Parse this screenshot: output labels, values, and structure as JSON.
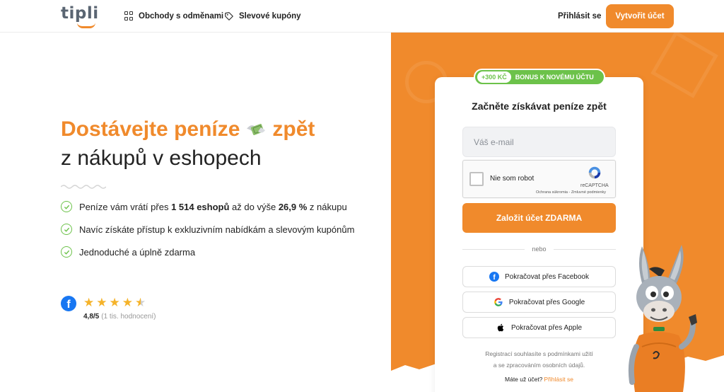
{
  "header": {
    "logo_text": "tipli",
    "nav": [
      {
        "label": "Obchody s odměnami",
        "icon": "grid-icon"
      },
      {
        "label": "Slevové kupóny",
        "icon": "tag-icon"
      }
    ],
    "login_label": "Přihlásit se",
    "create_account_label": "Vytvořit účet"
  },
  "hero": {
    "headline_highlight": "Dostávejte peníze",
    "headline_highlight_end": "zpět",
    "headline_rest": "z nákupů v eshopech",
    "benefits": [
      {
        "pre": "Peníze vám vrátí přes ",
        "bold1": "1 514 eshopů",
        "mid": " až do výše ",
        "bold2": "26,9 %",
        "post": " z nákupu"
      },
      {
        "text": "Navíc získáte přístup k exkluzivním nabídkám a slevovým kupónům"
      },
      {
        "text": "Jednoduché a úplně zdarma"
      }
    ],
    "rating": {
      "value": "4,8/5",
      "count": "(1 tis. hodnocení)",
      "stars": 4.5
    }
  },
  "signup": {
    "bonus_amount": "+300 KČ",
    "bonus_label": "BONUS K NOVÉMU ÚČTU",
    "title": "Začněte získávat peníze zpět",
    "email_placeholder": "Váš e-mail",
    "captcha_label": "Nie som robot",
    "captcha_brand": "reCAPTCHA",
    "captcha_links": "Ochrana súkromia - Zmluvné podmienky",
    "submit_label": "Založit účet ZDARMA",
    "or_label": "nebo",
    "social": [
      {
        "label": "Pokračovat přes Facebook",
        "icon": "facebook-icon"
      },
      {
        "label": "Pokračovat přes Google",
        "icon": "google-icon"
      },
      {
        "label": "Pokračovat přes Apple",
        "icon": "apple-icon"
      }
    ],
    "terms_line1": "Registrací souhlasíte s podmínkami užití",
    "terms_line2": "a se zpracováním osobních údajů.",
    "have_account": "Máte už účet?",
    "login_link": "Přihlásit se"
  },
  "colors": {
    "brand_orange": "#f08a2c",
    "accent_green": "#6cc24a",
    "facebook_blue": "#1877f2"
  }
}
